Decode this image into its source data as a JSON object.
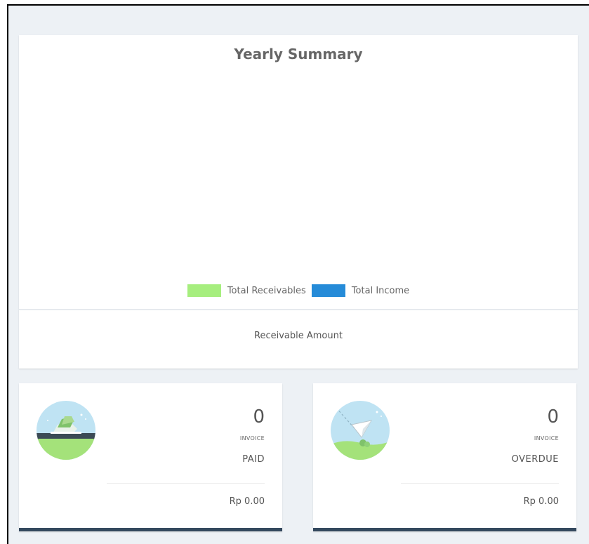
{
  "summary": {
    "title": "Yearly Summary",
    "legend": [
      {
        "label": "Total Receivables",
        "color": "#a6ee7e"
      },
      {
        "label": "Total Income",
        "color": "#258bd8"
      }
    ],
    "caption": "Receivable Amount"
  },
  "cards": {
    "paid": {
      "icon": "money-stack-icon",
      "count": "0",
      "count_label": "INVOICE",
      "status": "PAID",
      "amount": "Rp 0.00"
    },
    "overdue": {
      "icon": "paper-plane-icon",
      "count": "0",
      "count_label": "INVOICE",
      "status": "OVERDUE",
      "amount": "Rp 0.00"
    }
  },
  "colors": {
    "page_bg": "#edf1f5",
    "card_bar": "#34495e",
    "receivables": "#a6ee7e",
    "income": "#258bd8"
  }
}
